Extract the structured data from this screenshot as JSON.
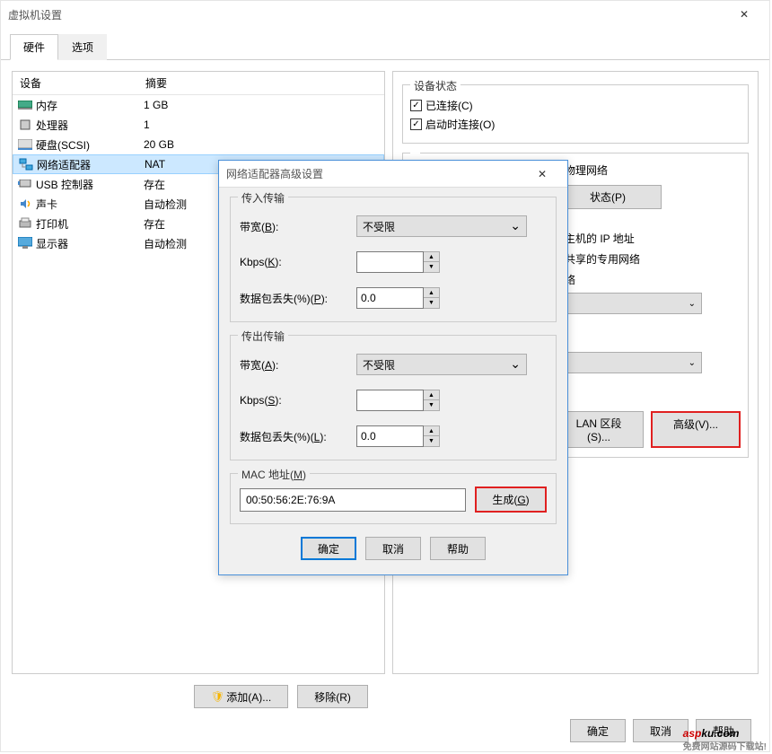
{
  "main": {
    "title": "虚拟机设置",
    "tabs": {
      "hardware": "硬件",
      "options": "选项"
    },
    "headers": {
      "device": "设备",
      "summary": "摘要"
    },
    "devices": [
      {
        "name": "内存",
        "summary": "1 GB",
        "icon": "ram"
      },
      {
        "name": "处理器",
        "summary": "1",
        "icon": "cpu"
      },
      {
        "name": "硬盘(SCSI)",
        "summary": "20 GB",
        "icon": "hdd"
      },
      {
        "name": "网络适配器",
        "summary": "NAT",
        "icon": "net",
        "selected": true
      },
      {
        "name": "USB 控制器",
        "summary": "存在",
        "icon": "usb"
      },
      {
        "name": "声卡",
        "summary": "自动检测",
        "icon": "sound"
      },
      {
        "name": "打印机",
        "summary": "存在",
        "icon": "printer"
      },
      {
        "name": "显示器",
        "summary": "自动检测",
        "icon": "display"
      }
    ],
    "add_btn": "添加(A)...",
    "remove_btn": "移除(R)",
    "footer": {
      "ok": "确定",
      "cancel": "取消",
      "help": "帮助"
    }
  },
  "right": {
    "status_title": "设备状态",
    "connected": "已连接(C)",
    "connect_at_power": "启动时连接(O)",
    "net_title_partial": "接物理网络",
    "state_btn_partial": "状态(P)",
    "nat_host_partial": "享主机的 IP 地址",
    "host_only_partial": "机共享的专用网络",
    "net_label_partial": "网络",
    "lan_btn": "LAN 区段(S)...",
    "advanced_btn": "高级(V)..."
  },
  "dialog": {
    "title": "网络适配器高级设置",
    "incoming": {
      "title": "传入传输",
      "bandwidth": "带宽(B):",
      "bandwidth_val": "不受限",
      "kbps": "Kbps(K):",
      "kbps_val": "",
      "loss": "数据包丢失(%)(P):",
      "loss_val": "0.0"
    },
    "outgoing": {
      "title": "传出传输",
      "bandwidth": "带宽(A):",
      "bandwidth_val": "不受限",
      "kbps": "Kbps(S):",
      "kbps_val": "",
      "loss": "数据包丢失(%)(L):",
      "loss_val": "0.0"
    },
    "mac": {
      "title": "MAC 地址(M)",
      "value": "00:50:56:2E:76:9A",
      "gen_btn": "生成(G)"
    },
    "ok": "确定",
    "cancel": "取消",
    "help": "帮助"
  },
  "watermark": {
    "t1": "asp",
    "t2": "ku",
    "t3": ".com",
    "sub": "免费网站源码下载站!"
  }
}
